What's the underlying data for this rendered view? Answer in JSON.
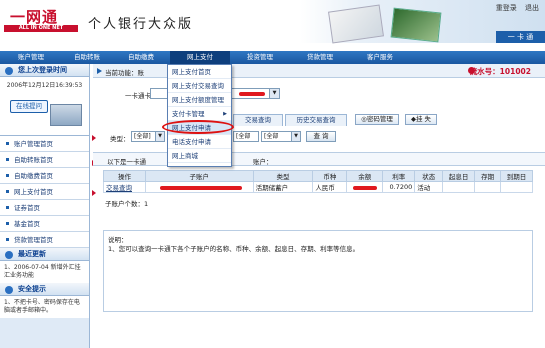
{
  "header": {
    "logo_text": "一网通",
    "logo_sub": "ALL IN ONE NET",
    "bank_name": "个人银行大众版",
    "top_links": [
      "重登录",
      "退出"
    ],
    "tag": "一 卡 通"
  },
  "nav": {
    "items": [
      "账户管理",
      "自助转账",
      "自助缴费",
      "网上支付",
      "投资管理",
      "贷款管理",
      "客户服务"
    ]
  },
  "left": {
    "login_title": "您上次登录时间",
    "login_time": "2006年12月12日16:39:53",
    "online_button": "在线提问",
    "menu": [
      "账户管理首页",
      "自助转账首页",
      "自助缴费首页",
      "网上支付首页",
      "证券首页",
      "基金首页",
      "贷款管理首页"
    ],
    "news_title": "最近更新",
    "news_text": "1、2006-07-04 新增外汇挂汇业务功能",
    "tips_title": "安全提示",
    "tips_text": "1、不把卡号、密码保存在电脑或者手邮箱中。"
  },
  "main": {
    "location_label": "当前功能：",
    "location_value": "账",
    "serial_label": "流水号：101002",
    "card_label": "一卡通卡号：",
    "tabs": [
      "交易查询",
      "历史交易查询"
    ],
    "pwd_btn": "密码管理",
    "print_btn": "挂 失",
    "type_label": "类型：",
    "type_value": "[全部]",
    "type2_value": "[全部",
    "type3_value": "[全部",
    "query_btn": "查 询",
    "list_title": "以下是一卡通",
    "list_title2": "账户：",
    "table_headers": [
      "操作",
      "子账户",
      "类型",
      "币种",
      "余额",
      "利率",
      "状态",
      "起息日",
      "存期",
      "到期日"
    ],
    "row": {
      "action": "交易查询",
      "type": "活期储蓄户",
      "currency": "人民币",
      "rate": "0.7200",
      "status": "活动"
    },
    "count_text": "子账户个数：1",
    "explain_title": "说明：",
    "explain_text": "1、您可以查询一卡通下各个子账户的名称、币种、余额、起息日、存期、利率等信息。"
  },
  "dropdown": {
    "items": [
      "网上支付首页",
      "网上支付交易查询",
      "网上支付额度管理",
      "支付卡管理",
      "网上支付申请",
      "电话支付申请",
      "网上商城"
    ],
    "highlighted": "网上支付申请"
  },
  "colors": {
    "nav_bg": "#1a57a0",
    "accent_red": "#c8102e",
    "panel_bg": "#dfeaf6"
  }
}
